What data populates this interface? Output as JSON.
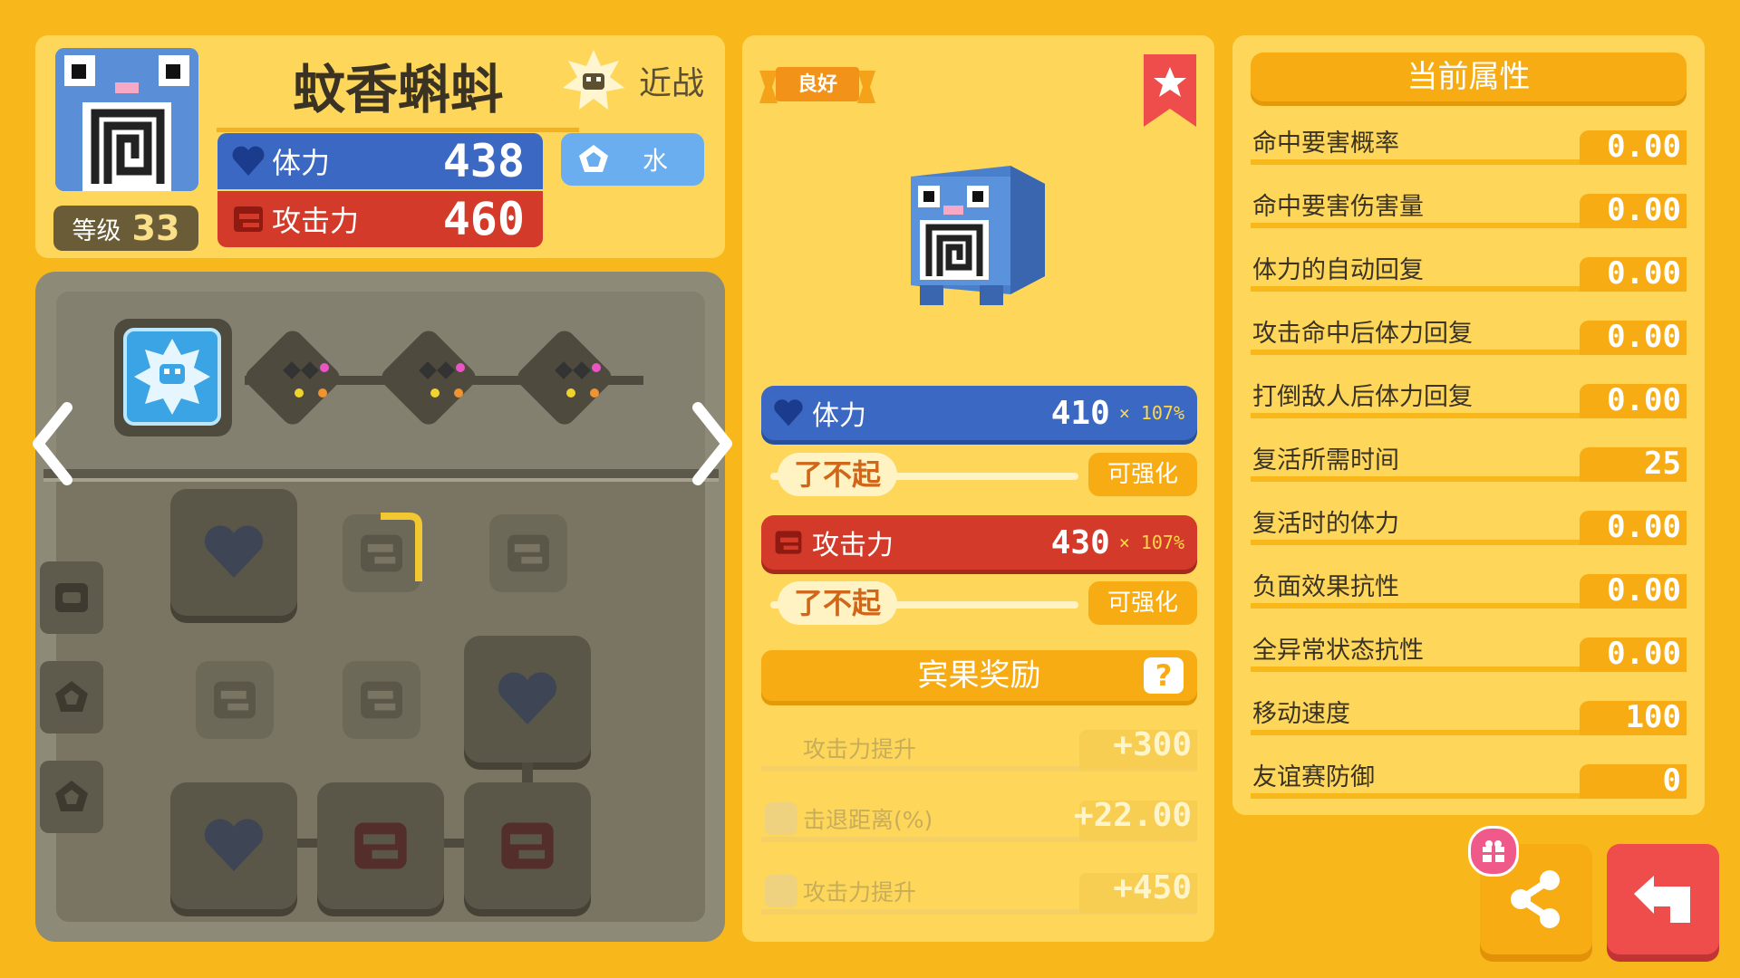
{
  "pokemon": {
    "name": "蚊香蝌蚪",
    "level_label": "等级",
    "level": "33",
    "style_label": "近战",
    "type_label": "水",
    "hp_label": "体力",
    "hp": "438",
    "atk_label": "攻击力",
    "atk": "460"
  },
  "grid": {
    "nav_left": "prev-arrow",
    "nav_right": "next-arrow"
  },
  "details": {
    "quality_badge": "良好",
    "hp_label": "体力",
    "hp_value": "410",
    "hp_mult": "× 107%",
    "hp_rank": "了不起",
    "hp_upgrade": "可强化",
    "atk_label": "攻击力",
    "atk_value": "430",
    "atk_mult": "× 107%",
    "atk_rank": "了不起",
    "atk_upgrade": "可强化",
    "bonus_title": "宾果奖励",
    "bonus_help": "?",
    "bonuses": [
      {
        "label": "攻击力提升",
        "value": "+300"
      },
      {
        "label": "击退距离(%)",
        "value": "+22.00"
      },
      {
        "label": "攻击力提升",
        "value": "+450"
      }
    ]
  },
  "attributes": {
    "title": "当前属性",
    "rows": [
      {
        "label": "命中要害概率",
        "value": "0.00"
      },
      {
        "label": "命中要害伤害量",
        "value": "0.00"
      },
      {
        "label": "体力的自动回复",
        "value": "0.00"
      },
      {
        "label": "攻击命中后体力回复",
        "value": "0.00"
      },
      {
        "label": "打倒敌人后体力回复",
        "value": "0.00"
      },
      {
        "label": "复活所需时间",
        "value": "25"
      },
      {
        "label": "复活时的体力",
        "value": "0.00"
      },
      {
        "label": "负面效果抗性",
        "value": "0.00"
      },
      {
        "label": "全异常状态抗性",
        "value": "0.00"
      },
      {
        "label": "移动速度",
        "value": "100"
      },
      {
        "label": "友谊赛防御",
        "value": "0"
      }
    ]
  },
  "colors": {
    "background": "#f8b81c",
    "panel": "#fdd65a",
    "hp_blue": "#3a68c2",
    "atk_red": "#d33a2a",
    "accent_orange": "#f8ac14"
  }
}
